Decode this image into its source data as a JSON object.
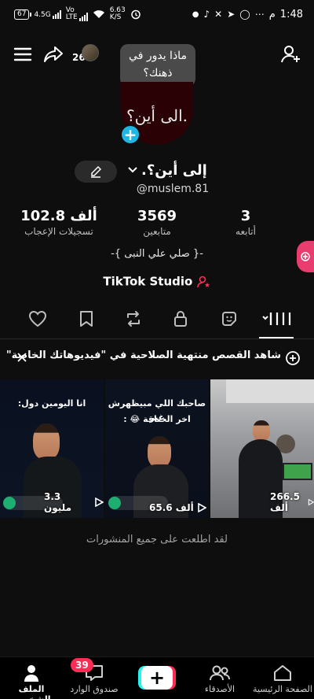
{
  "status_bar": {
    "battery": "67",
    "signal1": "4.5G",
    "signal2_top": "Vo",
    "signal2_bottom": "LTE",
    "speed_value": "6.63",
    "speed_unit": "K/S",
    "time": "1:48",
    "period": "م"
  },
  "top_bar": {
    "friends_count": "26",
    "tooltip_line1": "ماذا يدور في",
    "tooltip_line2": "ذهنك؟"
  },
  "profile": {
    "avatar_text": "الى أين؟.",
    "display_name": "إلى أين؟.",
    "username": "@muslem.81",
    "stats": [
      {
        "value": "3",
        "label": "أتابعه"
      },
      {
        "value": "3569",
        "label": "متابعين"
      },
      {
        "value": "102.8 ألف",
        "label": "تسجيلات الإعجاب"
      }
    ],
    "bio": "-{ صلي علي النبى }-",
    "studio_label": "TikTok Studio"
  },
  "banner": {
    "text": "شاهد القصص منتهية الصلاحية في \"فيديوهاتك الخاصة\""
  },
  "videos": [
    {
      "views": "266.5 ألف",
      "caption": ""
    },
    {
      "views": "65.6 ألف",
      "caption_line1": "صاحبك اللي مبيظهرش غير",
      "caption_line2": "اخر الخناقة 😂 :"
    },
    {
      "views": "3.3 مليون",
      "caption_line1": "انا اليومين دول:"
    }
  ],
  "end_text": "لقد اطلعت على جميع المنشورات",
  "bottom_nav": {
    "home": "الصفحة الرئيسية",
    "friends": "الأصدقاء",
    "inbox": "صندوق الوارد",
    "inbox_badge": "39",
    "profile": "الملف الشخصي"
  },
  "colors": {
    "accent_pink": "#fe2c55",
    "accent_cyan": "#25f4ee",
    "background": "#0e0e0e"
  }
}
